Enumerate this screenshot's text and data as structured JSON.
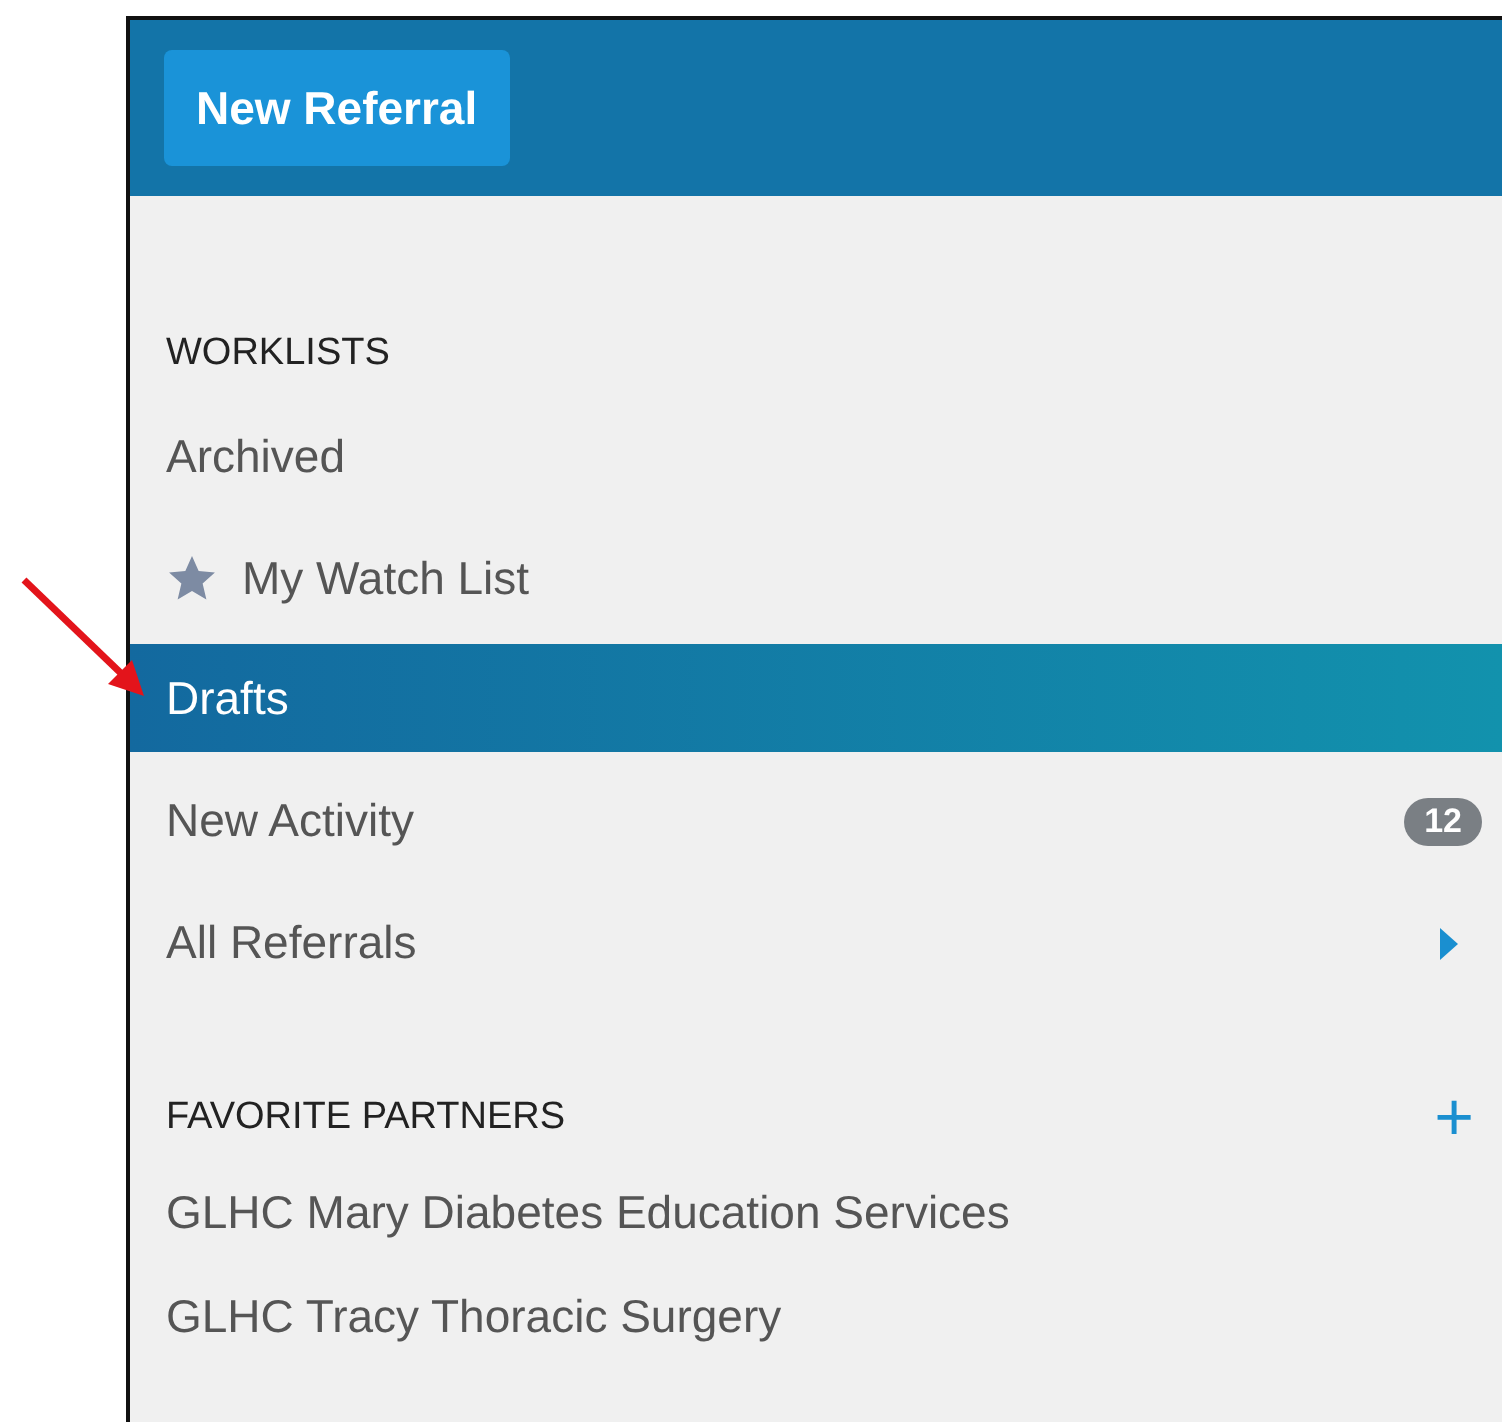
{
  "header": {
    "button": "New Referral"
  },
  "worklists": {
    "heading": "WORKLISTS",
    "items": [
      {
        "label": "Archived",
        "kind": "plain",
        "selected": false
      },
      {
        "label": "My Watch List",
        "kind": "star",
        "selected": false
      },
      {
        "label": "Drafts",
        "kind": "plain",
        "selected": true
      },
      {
        "label": "New Activity",
        "kind": "badge",
        "badge": "12",
        "selected": false
      },
      {
        "label": "All Referrals",
        "kind": "chevron",
        "selected": false
      }
    ]
  },
  "favorite_partners": {
    "heading": "FAVORITE PARTNERS",
    "add": "+",
    "items": [
      {
        "label": "GLHC Mary Diabetes Education Services"
      },
      {
        "label": "GLHC Tracy Thoracic Surgery"
      }
    ]
  }
}
